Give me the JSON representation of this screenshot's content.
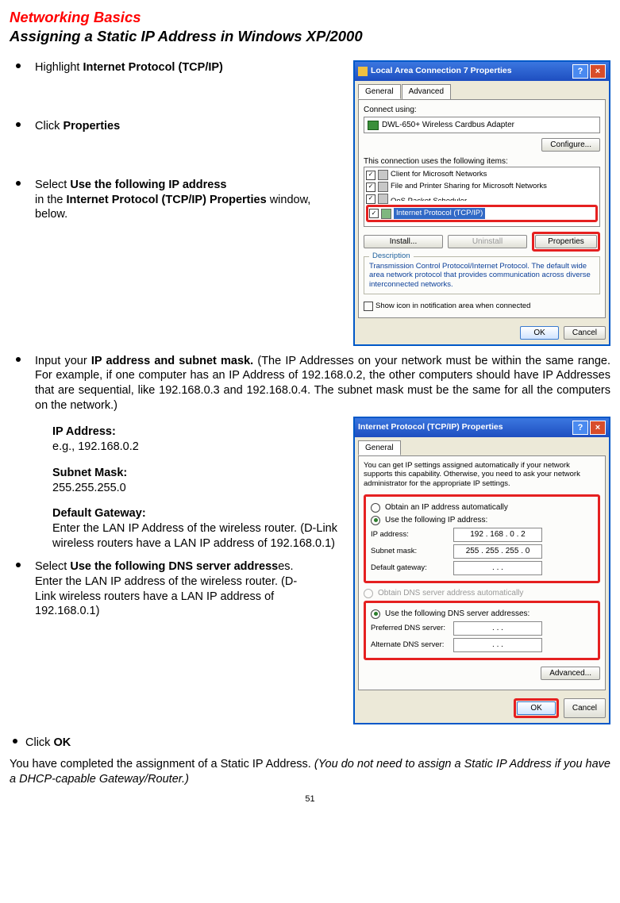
{
  "heading": {
    "title": "Networking Basics",
    "subtitle": "Assigning a Static IP Address in Windows XP/2000"
  },
  "bullets": {
    "b1a": "Highlight ",
    "b1b": "Internet Protocol (TCP/IP)",
    "b2a": "Click ",
    "b2b": "Properties",
    "b3a": "Select ",
    "b3b": "Use the following IP address",
    "b3c": "in the ",
    "b3d": "Internet Protocol (TCP/IP) Properties",
    "b3e": " window, below.",
    "b4a": "Input your ",
    "b4b": "IP address and subnet mask.",
    "b4c": " (The IP Addresses on your network must be within the same range. For example, if one computer has an IP Address of 192.168.0.2, the other computers should have IP Addresses that are sequential, like 192.168.0.3 and 192.168.0.4. The subnet mask must be the same for all the computers on the network.)",
    "ip_title": "IP Address:",
    "ip_eg": "e.g., 192.168.0.2",
    "sm_title": "Subnet Mask:",
    "sm_val": "255.255.255.0",
    "gw_title": "Default Gateway:",
    "gw_text": "Enter the LAN IP Address of the wireless router. (D-Link wireless routers have a LAN IP address of 192.168.0.1)",
    "b5a": "Select ",
    "b5b": "Use the following DNS server address",
    "b5c": "es.",
    "b5d": "Enter the LAN IP address of the wireless router. (D-Link wireless routers have a LAN IP address of 192.168.0.1)",
    "b6a": "Click ",
    "b6b": "OK"
  },
  "closing": {
    "a": "You have completed the assignment of a Static IP Address.  ",
    "b": "(You do not need to assign a Static IP Address if you have a DHCP-capable Gateway/Router.)"
  },
  "page_number": "51",
  "win1": {
    "title": "Local Area Connection 7 Properties",
    "tab_general": "General",
    "tab_advanced": "Advanced",
    "connect_using": "Connect using:",
    "adapter": "DWL-650+ Wireless Cardbus Adapter",
    "configure": "Configure...",
    "uses": "This connection uses the following items:",
    "item_client": "Client for Microsoft Networks",
    "item_fp": "File and Printer Sharing for Microsoft Networks",
    "item_qos": "QoS Packet Scheduler",
    "item_tcp": "Internet Protocol (TCP/IP)",
    "install": "Install...",
    "uninstall": "Uninstall",
    "properties": "Properties",
    "desc_legend": "Description",
    "desc_text": "Transmission Control Protocol/Internet Protocol. The default wide area network protocol that provides communication across diverse interconnected networks.",
    "show_icon": "Show icon in notification area when connected",
    "ok": "OK",
    "cancel": "Cancel"
  },
  "win2": {
    "title": "Internet Protocol (TCP/IP) Properties",
    "tab_general": "General",
    "intro": "You can get IP settings assigned automatically if your network supports this capability. Otherwise, you need to ask your network administrator for the appropriate IP settings.",
    "obtain_ip": "Obtain an IP address automatically",
    "use_ip": "Use the following IP address:",
    "ip_label": "IP address:",
    "ip_val": "192 . 168 .  0  .  2",
    "sm_label": "Subnet mask:",
    "sm_val": "255 . 255 . 255 .  0",
    "gw_label": "Default gateway:",
    "gw_val": ".        .        .",
    "obtain_dns": "Obtain DNS server address automatically",
    "use_dns": "Use the following DNS server addresses:",
    "pref_label": "Preferred DNS server:",
    "pref_val": ".        .        .",
    "alt_label": "Alternate DNS server:",
    "alt_val": ".        .        .",
    "advanced": "Advanced...",
    "ok": "OK",
    "cancel": "Cancel"
  }
}
